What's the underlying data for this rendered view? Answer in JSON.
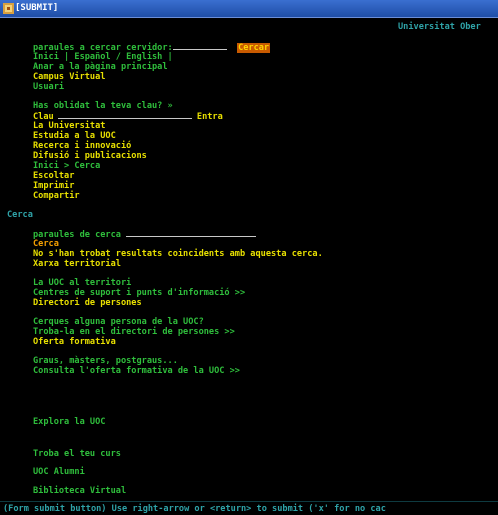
{
  "window": {
    "title": "[SUBMIT]"
  },
  "header": {
    "site_title": "Universitat Ober"
  },
  "search_top": {
    "label": "paraules a cercar cervidor:",
    "button": "Cercar"
  },
  "top_links": {
    "line1": "Inici | Español / English |",
    "home": "Anar a la pàgina principal",
    "campus": "Campus Virtual",
    "user_label": "Usuari",
    "forgot": "Has oblidat la teva clau? »",
    "password_label": "Clau",
    "enter": "Entra"
  },
  "nav": {
    "items": [
      "La Universitat",
      "Estudia a la UOC",
      "Recerca i innovació",
      "Difusió i publicacions",
      "Inici > Cerca",
      "Escoltar",
      "Imprimir",
      "Compartir"
    ]
  },
  "page_title": "Cerca",
  "search_main": {
    "label": "paraules de cerca",
    "button": "Cerca",
    "no_results": "No s'han trobat resultats coincidents amb aquesta cerca.",
    "network": "Xarxa territorial"
  },
  "territory": {
    "title": "La UOC al territori",
    "centers": "Centres de suport i punts d'informació >>",
    "directory": "Directori de persones"
  },
  "people": {
    "question": "Cerques alguna persona de la UOC?",
    "find": "Troba-la en el directori de persones >>",
    "offer": "Oferta formativa"
  },
  "degrees": {
    "title": "Graus, màsters, postgraus...",
    "consult": "Consulta l'oferta formativa de la UOC >>"
  },
  "bottom_links": [
    "Explora la UOC",
    "Troba el teu curs",
    "UOC Alumni",
    "Biblioteca Virtual"
  ],
  "status_bar": "(Form submit button) Use right-arrow or <return> to submit ('x' for no cac",
  "colors": {
    "background": "#000000",
    "link": "#2fbe3c",
    "text": "#e8e000",
    "button_bg": "#c85a00",
    "header": "#2fa3a8"
  }
}
